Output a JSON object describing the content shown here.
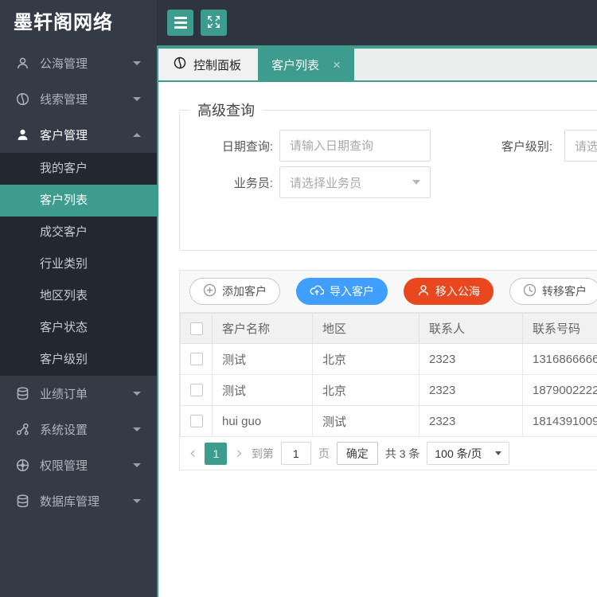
{
  "app": {
    "logo": "墨轩阁网络",
    "accent_color": "#3D9C8E",
    "topbar_color": "#2F3540",
    "sidebar_color": "#343B46"
  },
  "topbar": {
    "icons": [
      "menu-icon",
      "fullscreen-icon"
    ]
  },
  "tabs": [
    {
      "label": "控制面板",
      "icon": "globe-icon",
      "active": false
    },
    {
      "label": "客户列表",
      "active": true,
      "close_glyph": "×"
    }
  ],
  "sidebar": {
    "items": [
      {
        "label": "公海管理",
        "icon": "users-icon",
        "state": "collapsed"
      },
      {
        "label": "线索管理",
        "icon": "globe-icon",
        "state": "collapsed"
      },
      {
        "label": "客户管理",
        "icon": "user-icon",
        "state": "expanded",
        "active": true,
        "children": [
          {
            "label": "我的客户",
            "active": false
          },
          {
            "label": "客户列表",
            "active": true
          },
          {
            "label": "成交客户",
            "active": false
          },
          {
            "label": "行业类别",
            "active": false
          },
          {
            "label": "地区列表",
            "active": false
          },
          {
            "label": "客户状态",
            "active": false
          },
          {
            "label": "客户级别",
            "active": false
          }
        ]
      },
      {
        "label": "业绩订单",
        "icon": "database-icon",
        "state": "collapsed"
      },
      {
        "label": "系统设置",
        "icon": "nodes-icon",
        "state": "collapsed"
      },
      {
        "label": "权限管理",
        "icon": "wheel-icon",
        "state": "collapsed"
      },
      {
        "label": "数据库管理",
        "icon": "database-icon",
        "state": "collapsed"
      }
    ]
  },
  "query": {
    "legend": "高级查询",
    "fields": {
      "date": {
        "label": "日期查询:",
        "placeholder": "请输入日期查询"
      },
      "level": {
        "label": "客户级别:",
        "placeholder": "请选择客户级别"
      },
      "salesman": {
        "label": "业务员:",
        "placeholder": "请选择业务员"
      }
    }
  },
  "toolbar": {
    "buttons": [
      {
        "label": "添加客户",
        "icon": "plus-circle-icon",
        "style": "default"
      },
      {
        "label": "导入客户",
        "icon": "cloud-upload-icon",
        "style": "primary",
        "color": "#409EFF"
      },
      {
        "label": "移入公海",
        "icon": "user-icon",
        "style": "danger",
        "color": "#E9471D"
      },
      {
        "label": "转移客户",
        "icon": "clock-icon",
        "style": "default"
      }
    ]
  },
  "table": {
    "columns": [
      "客户名称",
      "地区",
      "联系人",
      "联系号码"
    ],
    "rows": [
      {
        "name": "测试",
        "region": "北京",
        "contact": "2323",
        "phone": "1316866666"
      },
      {
        "name": "测试",
        "region": "北京",
        "contact": "2323",
        "phone": "1879002222"
      },
      {
        "name": "hui guo",
        "region": "测试",
        "contact": "2323",
        "phone": "1814391009"
      }
    ]
  },
  "pagination": {
    "prev_glyph": "‹",
    "next_glyph": "›",
    "current_page": "1",
    "goto_label": "到第",
    "goto_value": "1",
    "page_word": "页",
    "confirm_label": "确定",
    "total_label": "共 3 条",
    "page_size": "100 条/页"
  }
}
